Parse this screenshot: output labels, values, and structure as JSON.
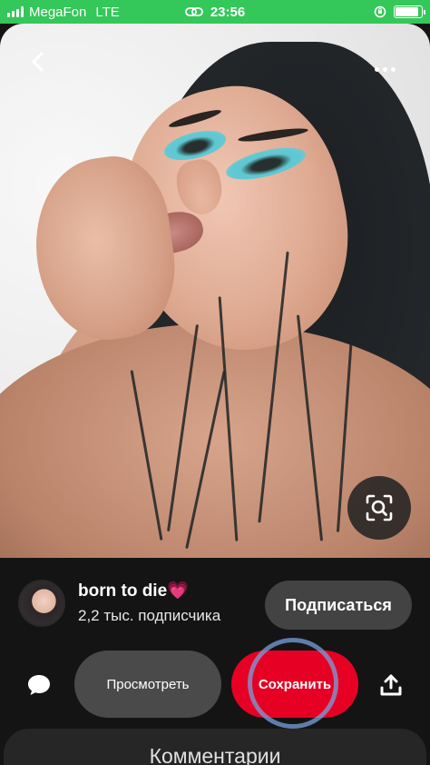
{
  "status_bar": {
    "carrier": "MegaFon",
    "network": "LTE",
    "time": "23:56",
    "battery_level": 0.9,
    "color": "#34c759"
  },
  "pin": {
    "icons": {
      "back": "chevron-left-icon",
      "more": "more-dots-icon",
      "visual_search": "lens-search-icon"
    }
  },
  "creator": {
    "name": "born to die💗",
    "followers": "2,2 тыс. подписчика",
    "follow_label": "Подписаться"
  },
  "actions": {
    "view_label": "Просмотреть",
    "save_label": "Сохранить",
    "save_color": "#e60023",
    "icons": {
      "comment": "speech-bubble-icon",
      "share": "share-upload-icon"
    }
  },
  "comments": {
    "title": "Комментарии"
  }
}
